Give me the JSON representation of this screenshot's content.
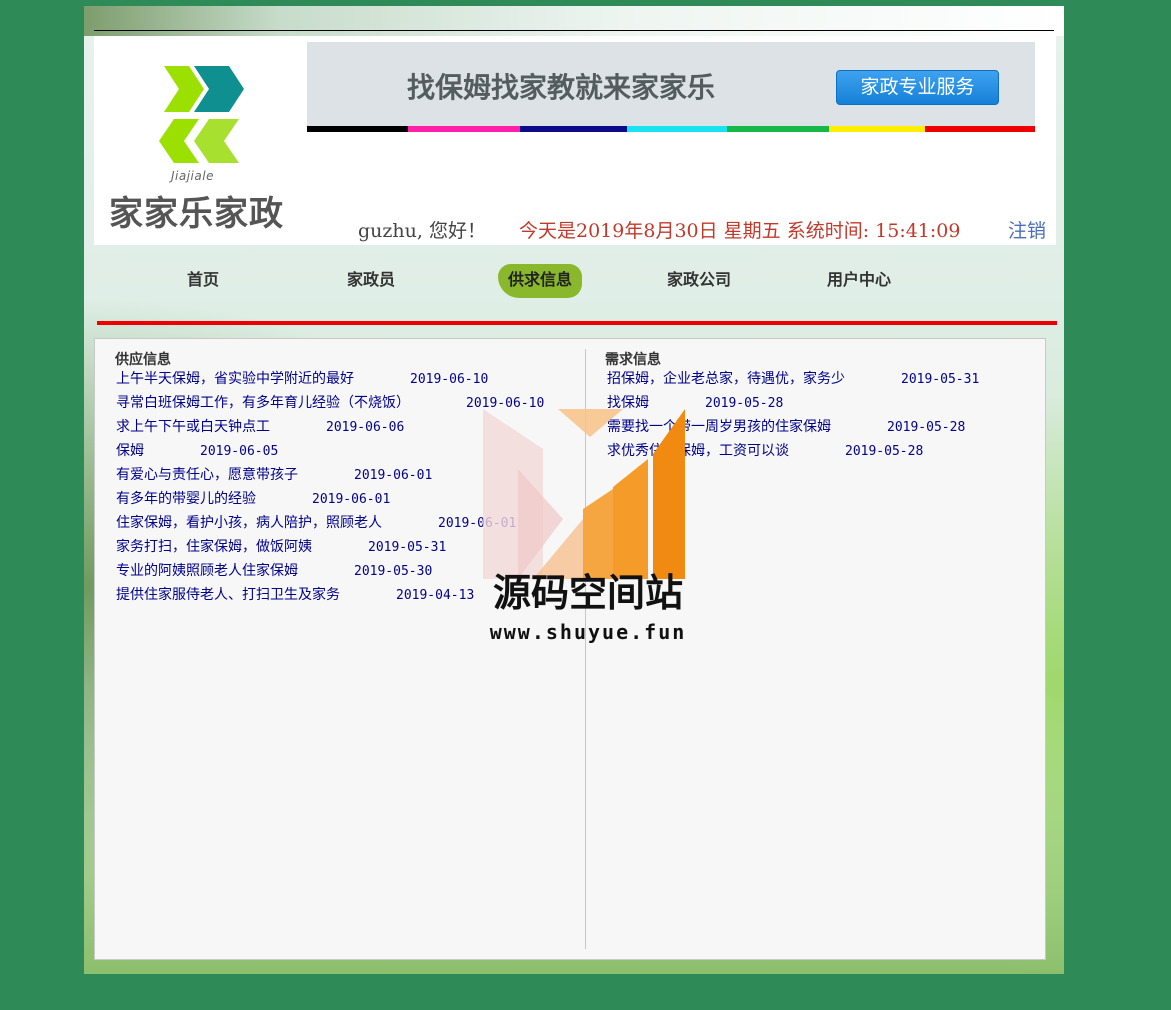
{
  "logo": {
    "subtitle": "Jiajiale",
    "title": "家家乐家政",
    "colors": [
      "#9be000",
      "#0f8f8f",
      "#a8e030"
    ]
  },
  "banner": {
    "slogan": "找保姆找家教就来家家乐",
    "button_label": "家政专业服务",
    "colorbar": [
      "#000000",
      "#ff1fa8",
      "#0a0a8a",
      "#19e3f0",
      "#17b84a",
      "#ffee00",
      "#ee0000"
    ]
  },
  "user_bar": {
    "greeting": "guzhu, 您好！",
    "datetime": "今天是2019年8月30日  星期五  系统时间: 15:41:09",
    "logout_label": "注销"
  },
  "nav": {
    "items": [
      {
        "label": "首页"
      },
      {
        "label": "家政员"
      },
      {
        "label": "供求信息",
        "active": true
      },
      {
        "label": "家政公司"
      },
      {
        "label": "用户中心"
      }
    ]
  },
  "supply": {
    "title": "供应信息",
    "rows": [
      {
        "title": "上午半天保姆，省实验中学附近的最好",
        "date": "2019-06-10"
      },
      {
        "title": "寻常白班保姆工作，有多年育儿经验（不烧饭）",
        "date": "2019-06-10"
      },
      {
        "title": "求上午下午或白天钟点工",
        "date": "2019-06-06"
      },
      {
        "title": "保姆",
        "date": "2019-06-05"
      },
      {
        "title": "有爱心与责任心，愿意带孩子",
        "date": "2019-06-01"
      },
      {
        "title": "有多年的带婴儿的经验",
        "date": "2019-06-01"
      },
      {
        "title": "住家保姆，看护小孩，病人陪护，照顾老人",
        "date": "2019-06-01"
      },
      {
        "title": "家务打扫，住家保姆，做饭阿姨",
        "date": "2019-05-31"
      },
      {
        "title": "专业的阿姨照顾老人住家保姆",
        "date": "2019-05-30"
      },
      {
        "title": "提供住家服侍老人、打扫卫生及家务",
        "date": "2019-04-13"
      }
    ]
  },
  "demand": {
    "title": "需求信息",
    "rows": [
      {
        "title": "招保姆，企业老总家，待遇优，家务少",
        "date": "2019-05-31"
      },
      {
        "title": "找保姆",
        "date": "2019-05-28"
      },
      {
        "title": "需要找一个带一周岁男孩的住家保姆",
        "date": "2019-05-28"
      },
      {
        "title": "求优秀住家保姆，工资可以谈",
        "date": "2019-05-28"
      }
    ]
  },
  "watermark": {
    "text": "源码空间站",
    "url": "www.shuyue.fun"
  }
}
